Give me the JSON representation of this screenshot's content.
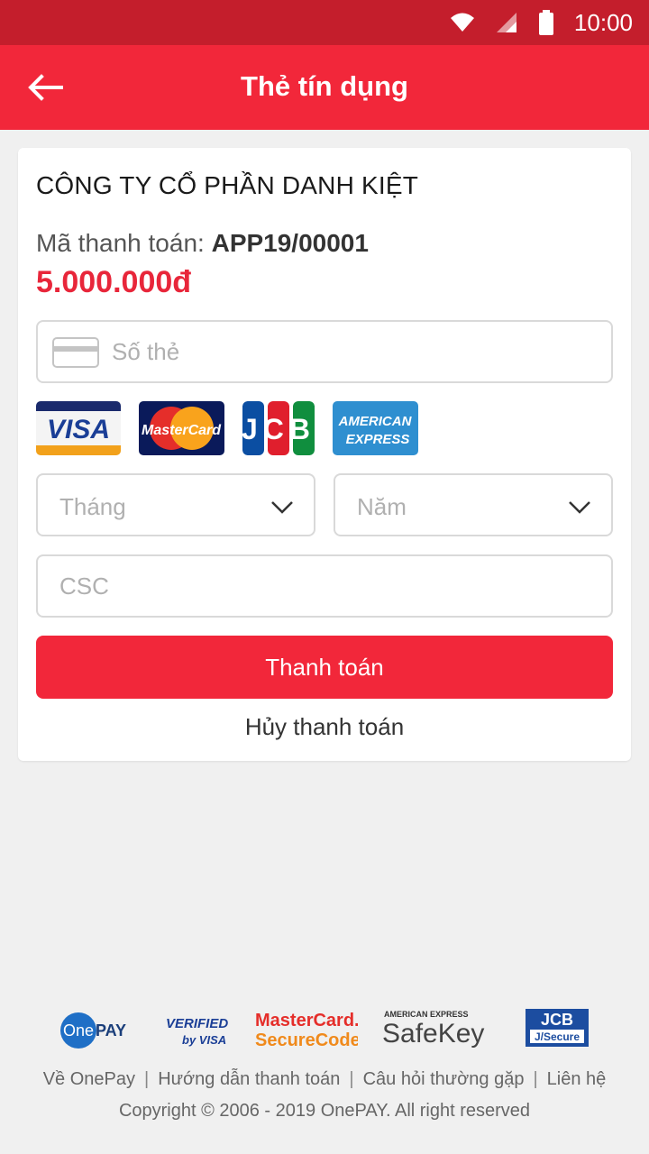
{
  "status_bar": {
    "time": "10:00"
  },
  "header": {
    "title": "Thẻ tín dụng"
  },
  "merchant": {
    "name": "CÔNG TY CỔ PHẦN DANH KIỆT",
    "payment_code_label": "Mã thanh toán:",
    "payment_code": "APP19/00001",
    "amount": "5.000.000đ"
  },
  "form": {
    "card_number_placeholder": "Số thẻ",
    "card_number_value": "",
    "month_placeholder": "Tháng",
    "year_placeholder": "Năm",
    "csc_placeholder": "CSC",
    "csc_value": "",
    "pay_label": "Thanh toán",
    "cancel_label": "Hủy thanh toán"
  },
  "card_brands": [
    {
      "name": "VISA"
    },
    {
      "name": "MasterCard"
    },
    {
      "name": "JCB"
    },
    {
      "name": "AMERICAN",
      "line2": "EXPRESS"
    }
  ],
  "partners": {
    "onepay_a": "One",
    "onepay_b": "PAY",
    "verified_a": "VERIFIED",
    "verified_b": "by VISA",
    "mc_a": "MasterCard.",
    "mc_b": "SecureCode.",
    "amex_a": "AMERICAN EXPRESS",
    "amex_b": "SafeKey",
    "jcb_a": "JCB",
    "jcb_b": "J/Secure"
  },
  "footer": {
    "links": [
      "Về OnePay",
      "Hướng dẫn thanh toán",
      "Câu hỏi thường gặp",
      "Liên hệ"
    ],
    "copyright": "Copyright © 2006 - 2019 OnePAY. All right reserved"
  },
  "colors": {
    "primary": "#f2273a",
    "status_bar": "#c41e2c",
    "background": "#f0f0f0"
  }
}
